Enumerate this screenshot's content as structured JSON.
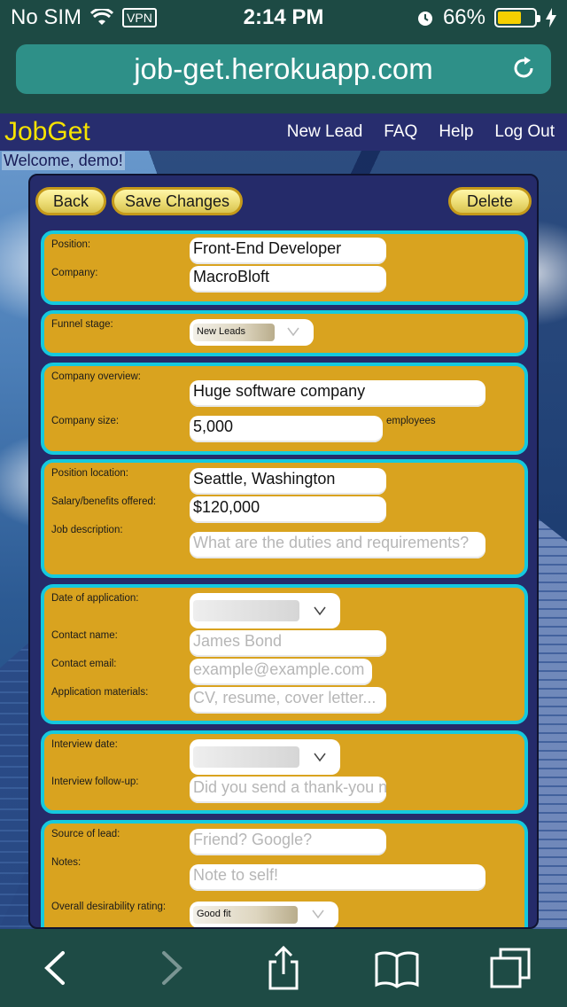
{
  "status_bar": {
    "carrier": "No SIM",
    "vpn": "VPN",
    "time": "2:14 PM",
    "battery": "66%",
    "battery_level": 0.66
  },
  "browser": {
    "url": "job-get.herokuapp.com"
  },
  "site": {
    "logo": "JobGet",
    "nav": [
      "New Lead",
      "FAQ",
      "Help",
      "Log Out"
    ],
    "welcome": "Welcome, demo!"
  },
  "actions": {
    "back": "Back",
    "save": "Save Changes",
    "delete": "Delete"
  },
  "form": {
    "position_label": "Position:",
    "position_value": "Front-End Developer",
    "company_label": "Company:",
    "company_value": "MacroBloft",
    "funnel_label": "Funnel stage:",
    "funnel_value": "New Leads",
    "overview_label": "Company overview:",
    "overview_value": "Huge software company",
    "size_label": "Company size:",
    "size_value": "5,000",
    "size_unit": "employees",
    "location_label": "Position location:",
    "location_value": "Seattle, Washington",
    "salary_label": "Salary/benefits offered:",
    "salary_value": "$120,000",
    "jobdesc_label": "Job description:",
    "jobdesc_placeholder": "What are the duties and requirements?",
    "app_date_label": "Date of application:",
    "contact_name_label": "Contact name:",
    "contact_name_placeholder": "James Bond",
    "contact_email_label": "Contact email:",
    "contact_email_placeholder": "example@example.com",
    "materials_label": "Application materials:",
    "materials_placeholder": "CV, resume, cover letter...",
    "interview_date_label": "Interview date:",
    "followup_label": "Interview follow-up:",
    "followup_placeholder": "Did you send a thank-you no",
    "source_label": "Source of lead:",
    "source_placeholder": "Friend? Google?",
    "notes_label": "Notes:",
    "notes_placeholder": "Note to self!",
    "rating_label": "Overall desirability rating:",
    "rating_value": "Good fit"
  },
  "icons": {
    "wifi": "wifi-icon",
    "alarm": "alarm-icon",
    "charging": "charging-icon",
    "reload": "reload-icon",
    "back": "back-arrow-icon",
    "forward": "forward-arrow-icon",
    "share": "share-icon",
    "bookmarks": "bookmarks-icon",
    "tabs": "tabs-icon"
  },
  "colors": {
    "card": "#d9a31f",
    "card_border": "#15c9de",
    "logo": "#f6e300",
    "panel": "#252b6a"
  }
}
